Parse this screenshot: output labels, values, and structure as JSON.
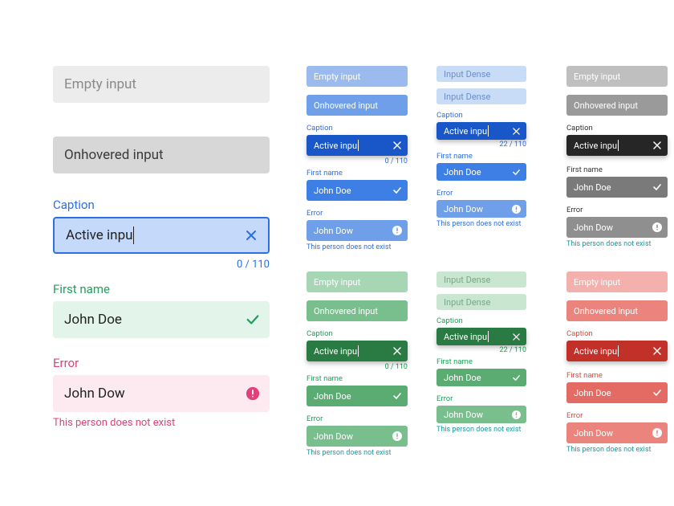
{
  "text": {
    "empty": "Empty input",
    "hover": "Onhovered input",
    "caption": "Caption",
    "active": "Active inpu",
    "counter": "0 / 110",
    "counter_sm": "22 / 110",
    "firstname": "First name",
    "doe": "John Doe",
    "error": "Error",
    "dow": "John Dow",
    "noexist": "This person does not exist",
    "dense": "Input Dense"
  },
  "palette": {
    "neutral_empty": "#ECECEC",
    "neutral_empty_text": "#8a8a8a",
    "neutral_hover": "#D7D7D7",
    "neutral_hover_text": "#3a3a3a",
    "blue_label": "#2f6fe4",
    "blue_active_bg": "#C5DAFA",
    "blue_active_border": "#2f6fe4",
    "blue_x": "#2f6fe4",
    "blue_counter": "#2f6fe4",
    "green_label": "#1ea15a",
    "green_bg": "#E3F5EA",
    "green_check": "#1ea15a",
    "pink_label": "#e04178",
    "pink_bg": "#FCEAF0",
    "pink_badge": "#e04178",
    "blue_empty": "#9bbbee",
    "blue_hover": "#6f9fe8",
    "blue_active": "#1957c9",
    "blue_valid": "#3d7fe5",
    "blue_error": "#6f9fe8",
    "grey_empty": "#bfbfbf",
    "grey_hover": "#9a9a9a",
    "grey_active": "#262626",
    "grey_valid": "#7a7a7a",
    "grey_error": "#8f8f8f",
    "green_empty": "#a7d6b4",
    "green_hover": "#79bf8d",
    "green_active": "#2a7a43",
    "green_valid": "#5aac73",
    "green_error": "#79bf8d",
    "red_empty": "#f3b0ac",
    "red_hover": "#ec847e",
    "red_active": "#c13129",
    "red_valid": "#e46b63",
    "red_error": "#ec847e",
    "dense_pill": "#c9dcf7",
    "dense_pill_green": "#c8e6d0",
    "dense_blue_active": "#1957c9",
    "dense_green_active": "#2a7a43",
    "teal_helper": "#1b9aa0"
  }
}
